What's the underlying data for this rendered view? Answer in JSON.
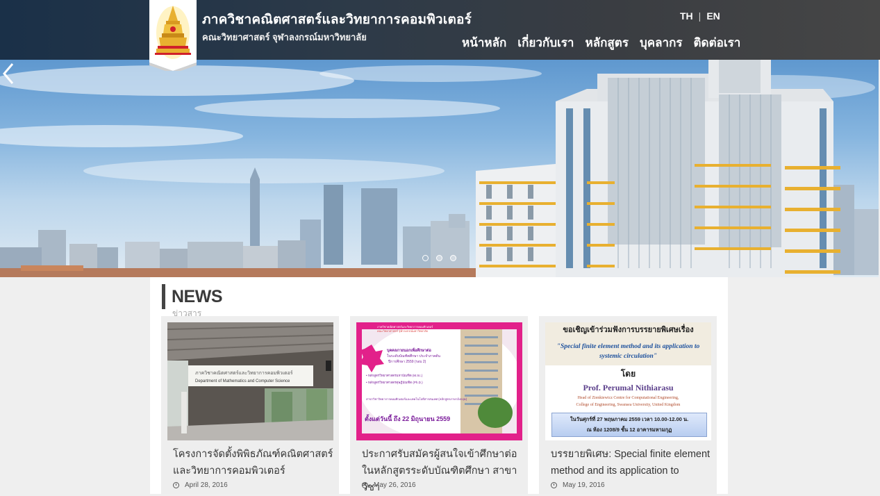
{
  "header": {
    "title": "ภาควิชาคณิตศาสตร์และวิทยาการคอมพิวเตอร์",
    "subtitle": "คณะวิทยาศาสตร์ จุฬาลงกรณ์มหาวิทยาลัย",
    "languages": [
      "TH",
      "EN"
    ],
    "nav": [
      "หน้าหลัก",
      "เกี่ยวกับเรา",
      "หลักสูตร",
      "บุคลากร",
      "ติดต่อเรา"
    ]
  },
  "carousel": {
    "slide_count": 3,
    "active_index": 0
  },
  "news": {
    "heading": "NEWS",
    "subheading": "ข่าวสาร",
    "items": [
      {
        "title": "โครงการจัดตั้งพิพิธภัณฑ์คณิตศาสตร์และวิทยาการคอมพิวเตอร์",
        "date": "April 28, 2016",
        "sign_th": "ภาควิชาคณิตศาสตร์และวิทยาการคอมพิวเตอร์",
        "sign_en": "Department of Mathematics and Computer Science"
      },
      {
        "title": "ประกาศรับสมัครผู้สนใจเข้าศึกษาต่อในหลักสูตรระดับบัณฑิตศึกษา สาขาวิชา",
        "date": "May 26, 2016",
        "poster": {
          "header1": "ภาควิชาคณิตศาสตร์และวิทยาการคอมพิวเตอร์",
          "header2": "คณะวิทยาศาสตร์ จุฬาลงกรณ์มหาวิทยาลัย",
          "line1": "บุคคลภายนอกเพื่อศึกษาต่อ",
          "line2": "ในระดับบัณฑิตศึกษา ประจำภาคต้น",
          "line3": "ปีการศึกษา 2559 (รอบ 2)",
          "bullet1": "• หลักสูตรวิทยาศาสตรมหาบัณฑิต (M.Sc.)",
          "bullet2": "• หลักสูตรวิทยาศาสตรดุษฎีบัณฑิต (Ph.D.)",
          "major": "สาขาวิชาวิทยาการคอมพิวเตอร์และเทคโนโลยีสารสนเทศ (หลักสูตรภาษาอังกฤษ)",
          "date_line": "ตั้งแต่วันนี้ ถึง 22 มิถุนายน 2559"
        }
      },
      {
        "title": "บรรยายพิเศษ: Special finite element method and its application to",
        "date": "May 19, 2016",
        "poster": {
          "invite": "ขอเชิญเข้าร่วมฟังการบรรยายพิเศษเรื่อง",
          "topic": "\"Special finite element method and its application to systemic circulation\"",
          "by": "โดย",
          "speaker": "Prof. Perumal Nithiarasu",
          "affil1": "Head of Zienkiewicz Centre for Computational Engineering,",
          "affil2": "College of Engineering, Swansea University, United Kingdom",
          "when": "ในวันศุกร์ที่ 27 พฤษภาคม 2559 เวลา 10.00-12.00 น.",
          "where": "ณ ห้อง 1208/9 ชั้น 12 อาคารมหามกุฏ"
        }
      }
    ]
  },
  "colors": {
    "header_dark": "#1a3048",
    "header_light": "#464646",
    "accent_gold": "#e8b030",
    "poster_pink": "#e2218a"
  }
}
